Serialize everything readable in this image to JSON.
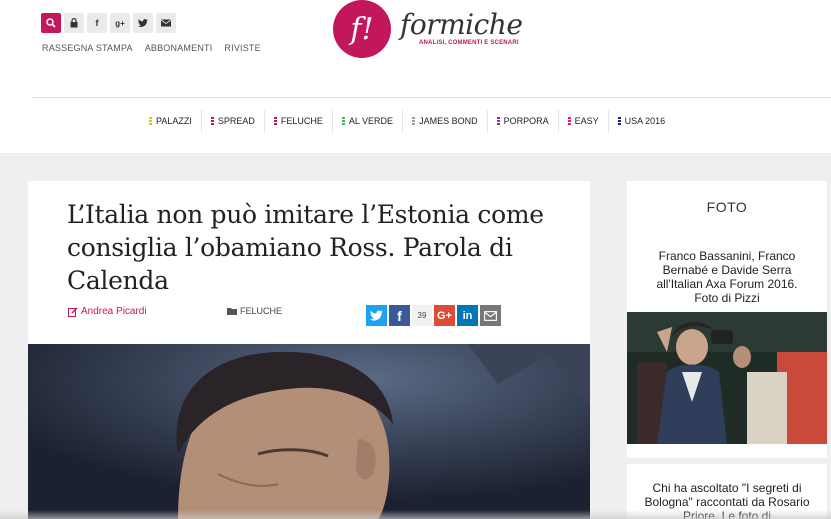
{
  "header": {
    "top_links": [
      "RASSEGNA STAMPA",
      "ABBONAMENTI",
      "RIVISTE"
    ],
    "logo": {
      "mark": "f!",
      "word": "formiche",
      "tagline": "ANALISI, COMMENTI E SCENARI"
    },
    "icons": [
      "search-icon",
      "lock-icon",
      "facebook-icon",
      "google-plus-icon",
      "twitter-icon",
      "mail-icon"
    ]
  },
  "nav": {
    "items": [
      {
        "label": "PALAZZI",
        "color": "#f2c200"
      },
      {
        "label": "SPREAD",
        "color": "#c2185b"
      },
      {
        "label": "FELUCHE",
        "color": "#c2185b"
      },
      {
        "label": "AL VERDE",
        "color": "#4caf50"
      },
      {
        "label": "JAMES BOND",
        "color": "#9e9e9e"
      },
      {
        "label": "PORPORA",
        "color": "#9c27b0"
      },
      {
        "label": "EASY",
        "color": "#e91e63"
      },
      {
        "label": "USA 2016",
        "color": "#1a237e"
      }
    ]
  },
  "article": {
    "title": "L’Italia non può imitare l’Estonia come consiglia l’obamiano Ross. Parola di Calenda",
    "author": "Andrea Picardi",
    "category": "FELUCHE",
    "share_count": "39",
    "share_icons": [
      "twitter-icon",
      "facebook-icon",
      "google-plus-icon",
      "linkedin-icon",
      "email-icon"
    ]
  },
  "sidebar": {
    "title": "FOTO",
    "items": [
      {
        "caption": "Franco Bassanini, Franco Bernabé e Davide Serra all'Italian Axa Forum 2016. Foto di Pizzi"
      },
      {
        "caption": "Chi ha ascoltato \"I segreti di Bologna\" raccontati da Rosario Priore. Le foto di"
      }
    ]
  },
  "colors": {
    "brand": "#c2185b",
    "twitter": "#1da1f2",
    "facebook": "#3b5998",
    "google_plus": "#dd4b39",
    "linkedin": "#0077b5",
    "email": "#777777"
  }
}
